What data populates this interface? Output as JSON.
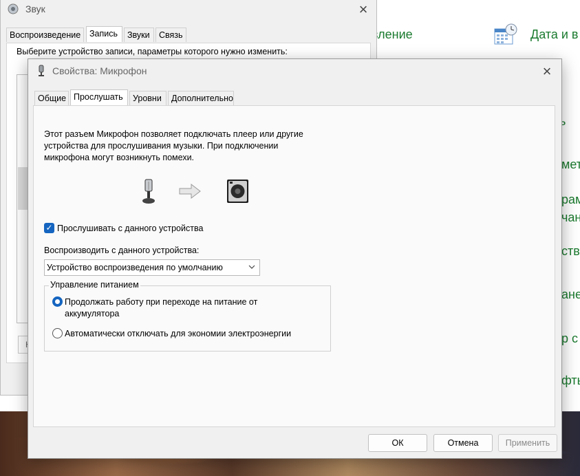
{
  "control_panel": {
    "items": [
      "вление",
      "Дата и в",
      "ь",
      "мет",
      "рам",
      "чан",
      "ств",
      "ане",
      "р с",
      "фты"
    ]
  },
  "sound_window": {
    "title": "Звук",
    "tabs": [
      "Воспроизведение",
      "Запись",
      "Звуки",
      "Связь"
    ],
    "hint": "Выберите устройство записи, параметры которого нужно изменить:",
    "button_partial": "Н"
  },
  "dialog": {
    "title": "Свойства: Микрофон",
    "tabs": [
      "Общие",
      "Прослушать",
      "Уровни",
      "Дополнительно"
    ],
    "description": "Этот разъем Микрофон позволяет подключать плеер или другие\nустройства для прослушивания музыки. При подключении\nмикрофона могут возникнуть помехи.",
    "listen_checkbox": {
      "label": "Прослушивать с данного устройства",
      "checked": true
    },
    "playback_label": "Воспроизводить с данного устройства:",
    "playback_device": "Устройство воспроизведения по умолчанию",
    "power": {
      "title": "Управление питанием",
      "options": [
        {
          "label": "Продолжать работу при переходе на питание от аккумулятора",
          "selected": true
        },
        {
          "label": "Автоматически отключать для экономии электроэнергии",
          "selected": false
        }
      ]
    },
    "buttons": {
      "ok": "ОК",
      "cancel": "Отмена",
      "apply": "Применить"
    }
  },
  "colors": {
    "accent": "#1565c0",
    "link_green": "#1a7a2e"
  }
}
